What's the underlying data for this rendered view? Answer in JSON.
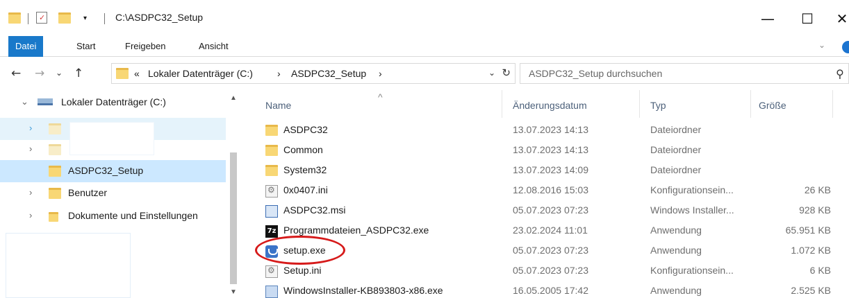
{
  "window": {
    "title": "C:\\ASDPC32_Setup",
    "minimize_glyph": "—",
    "maximize_glyph": "☐",
    "close_glyph": "✕"
  },
  "ribbon": {
    "tabs": [
      "Datei",
      "Start",
      "Freigeben",
      "Ansicht"
    ],
    "active_tab": "Datei",
    "expand_glyph": "⌄"
  },
  "address": {
    "back_glyph": "←",
    "forward_glyph": "→",
    "recent_glyph": "⌄",
    "up_glyph": "↑",
    "overflow": "«",
    "crumbs": [
      "Lokaler Datenträger (C:)",
      "ASDPC32_Setup"
    ],
    "crumb_sep": "›",
    "dropdown_glyph": "⌄",
    "refresh_glyph": "↻"
  },
  "search": {
    "placeholder": "ASDPC32_Setup durchsuchen",
    "icon": "search-icon",
    "icon_glyph": "⚲"
  },
  "nav": {
    "drive_label": "Lokaler Datenträger (C:)",
    "items": [
      {
        "label": ""
      },
      {
        "label": ""
      },
      {
        "label": "ASDPC32_Setup"
      },
      {
        "label": "Benutzer"
      },
      {
        "label": "Dokumente und Einstellungen"
      }
    ],
    "expand_glyph": "⌄",
    "collapse_glyph": "›"
  },
  "columns": {
    "name": "Name",
    "date": "Änderungsdatum",
    "type": "Typ",
    "size": "Größe",
    "sort_glyph": "^"
  },
  "files": [
    {
      "name": "ASDPC32",
      "date": "13.07.2023 14:13",
      "type": "Dateiordner",
      "size": "",
      "icon": "folder-icon"
    },
    {
      "name": "Common",
      "date": "13.07.2023 14:13",
      "type": "Dateiordner",
      "size": "",
      "icon": "folder-icon"
    },
    {
      "name": "System32",
      "date": "13.07.2023 14:09",
      "type": "Dateiordner",
      "size": "",
      "icon": "folder-icon"
    },
    {
      "name": "0x0407.ini",
      "date": "12.08.2016 15:03",
      "type": "Konfigurationsein...",
      "size": "26 KB",
      "icon": "ini-file-icon"
    },
    {
      "name": "ASDPC32.msi",
      "date": "05.07.2023 07:23",
      "type": "Windows Installer...",
      "size": "928 KB",
      "icon": "msi-file-icon"
    },
    {
      "name": "Programmdateien_ASDPC32.exe",
      "date": "23.02.2024 11:01",
      "type": "Anwendung",
      "size": "65.951 KB",
      "icon": "7z-exe-icon",
      "icon_glyph": "7z"
    },
    {
      "name": "setup.exe",
      "date": "05.07.2023 07:23",
      "type": "Anwendung",
      "size": "1.072 KB",
      "icon": "setup-exe-icon"
    },
    {
      "name": "Setup.ini",
      "date": "05.07.2023 07:23",
      "type": "Konfigurationsein...",
      "size": "6 KB",
      "icon": "ini-file-icon"
    },
    {
      "name": "WindowsInstaller-KB893803-x86.exe",
      "date": "16.05.2005 17:42",
      "type": "Anwendung",
      "size": "2.525 KB",
      "icon": "installer-exe-icon"
    }
  ],
  "colors": {
    "accent": "#1979ca",
    "selection": "#cce8ff",
    "hover": "#e5f3fb",
    "annotation": "#d61a1a",
    "folder": "#f8d775"
  }
}
